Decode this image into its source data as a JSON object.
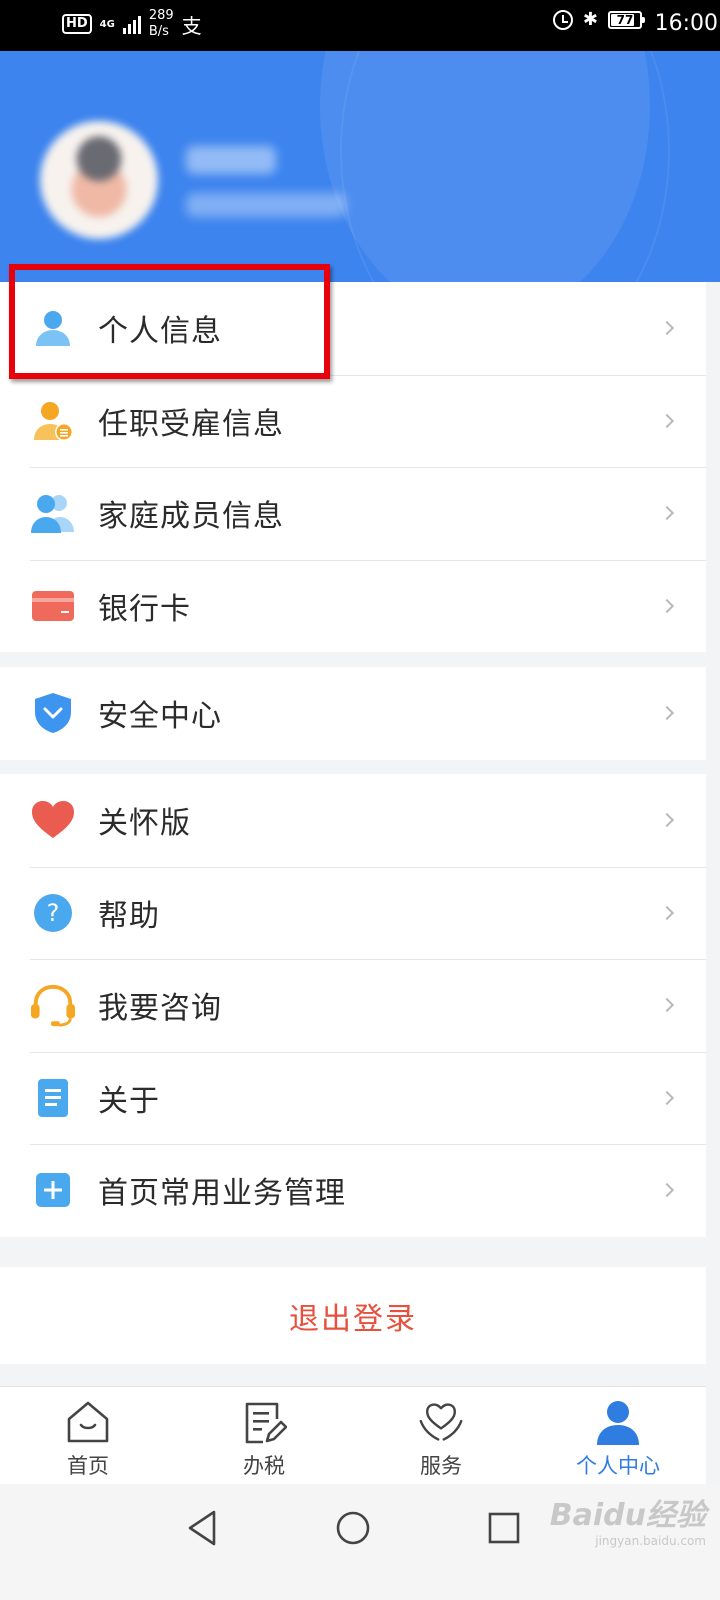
{
  "status_bar": {
    "hd": "HD",
    "network": "4G",
    "speed_value": "289",
    "speed_unit": "B/s",
    "battery": "77",
    "time": "16:00"
  },
  "menu_groups": [
    {
      "items": [
        {
          "label": "个人信息",
          "icon": "person-icon",
          "color": "#4aa8ee"
        },
        {
          "label": "任职受雇信息",
          "icon": "employee-badge-icon",
          "color": "#f5a623"
        },
        {
          "label": "家庭成员信息",
          "icon": "family-icon",
          "color": "#4aa8ee"
        },
        {
          "label": "银行卡",
          "icon": "bank-card-icon",
          "color": "#ef6a5b"
        }
      ]
    },
    {
      "items": [
        {
          "label": "安全中心",
          "icon": "shield-icon",
          "color": "#3d95ef"
        }
      ]
    },
    {
      "items": [
        {
          "label": "关怀版",
          "icon": "heart-icon",
          "color": "#ea5b50"
        },
        {
          "label": "帮助",
          "icon": "question-icon",
          "color": "#4aa8ee"
        },
        {
          "label": "我要咨询",
          "icon": "headset-icon",
          "color": "#f5a623"
        },
        {
          "label": "关于",
          "icon": "document-icon",
          "color": "#4aa8ee"
        },
        {
          "label": "首页常用业务管理",
          "icon": "plus-square-icon",
          "color": "#4aa8ee"
        }
      ]
    }
  ],
  "logout_label": "退出登录",
  "tabbar": {
    "tabs": [
      {
        "label": "首页",
        "icon": "home-icon"
      },
      {
        "label": "办税",
        "icon": "tax-form-icon"
      },
      {
        "label": "服务",
        "icon": "service-heart-icon"
      },
      {
        "label": "个人中心",
        "icon": "user-center-icon",
        "active": true
      }
    ]
  },
  "colors": {
    "header_blue": "#3d84ee",
    "active_blue": "#2f7de1",
    "logout_red": "#e8503d",
    "highlight_red": "#e8000b"
  },
  "watermark": {
    "brand": "Baidu经验",
    "url": "jingyan.baidu.com"
  }
}
